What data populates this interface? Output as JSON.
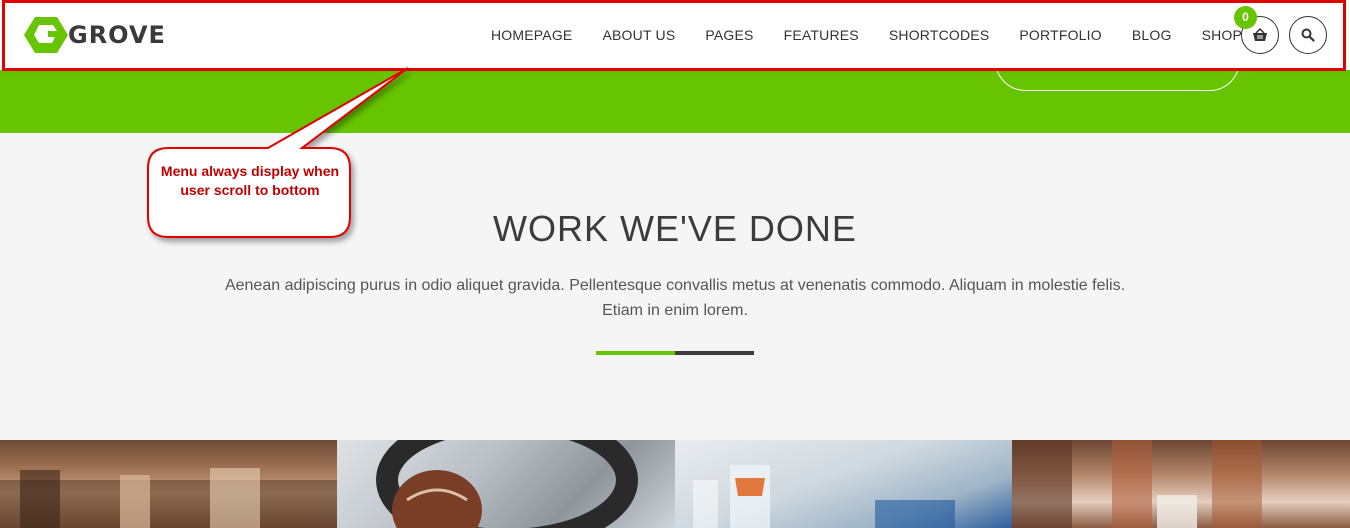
{
  "header": {
    "logo_text": "GROVE",
    "nav": [
      {
        "label": "HOMEPAGE"
      },
      {
        "label": "ABOUT US"
      },
      {
        "label": "PAGES"
      },
      {
        "label": "FEATURES"
      },
      {
        "label": "SHORTCODES"
      },
      {
        "label": "PORTFOLIO"
      },
      {
        "label": "BLOG"
      },
      {
        "label": "SHOP"
      }
    ],
    "cart_count": "0",
    "cart_icon": "basket-icon",
    "search_icon": "search-icon"
  },
  "annotation": {
    "callout_text": "Menu always display when user scroll to bottom",
    "color": "#e00000"
  },
  "section": {
    "title": "WORK WE'VE DONE",
    "description": "Aenean adipiscing purus in odio aliquet gravida. Pellentesque convallis metus at venenatis commodo. Aliquam in molestie felis. Etiam in enim lorem."
  },
  "colors": {
    "accent": "#66c400",
    "text_dark": "#3c3c3c",
    "background": "#f5f5f5"
  },
  "portfolio": {
    "items": [
      {
        "subject": "restaurant-interior"
      },
      {
        "subject": "steering-wheel-glove"
      },
      {
        "subject": "drinks-glasses"
      },
      {
        "subject": "cafe-window"
      }
    ]
  }
}
